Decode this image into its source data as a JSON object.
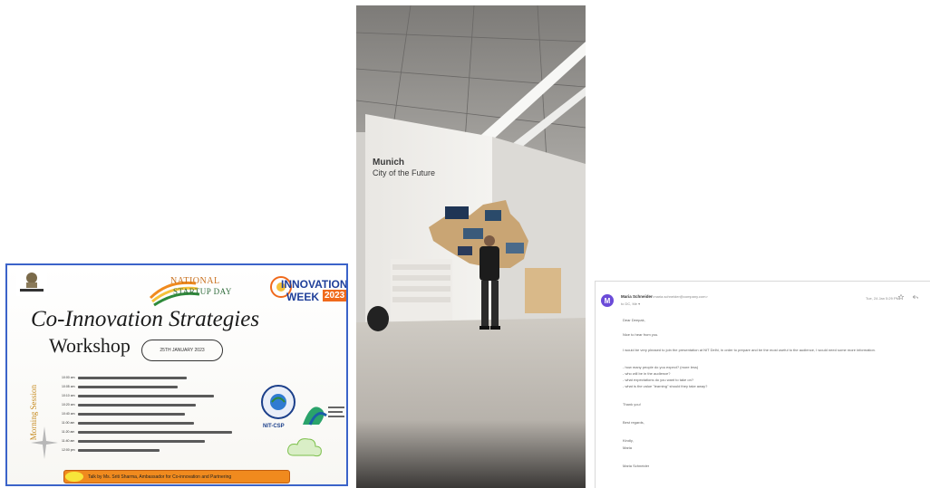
{
  "poster": {
    "title": "Co-Innovation Strategies",
    "subtitle": "Workshop",
    "date": "25TH JANUARY 2023",
    "startup_line1": "NATIONAL",
    "startup_line2": "STARTUP DAY",
    "innovation_line1": "INNOVATION",
    "innovation_line2": "WEEK",
    "innovation_year": "2023",
    "side_text": "Morning Session",
    "nit_label": "NIT-CSP",
    "schedule": [
      {
        "time": "10:00 am",
        "text": "Welcome Address By Dr. Deepak Bansal"
      },
      {
        "time": "10:05 am",
        "text": "Inaugural Address By Director NITSRITCH Delhi"
      },
      {
        "time": "10:10 am",
        "text": "Chief Guest Address By Ms. Surya Kumar Bose (Founder IIT Chennai)"
      },
      {
        "time": "10:20 am",
        "text": "Innovation Talk By Ms. Lee Ima (Hamburg Germany)"
      },
      {
        "time": "10:40 am",
        "text": "Co-innovation India Talk By Shri N Ramanan"
      },
      {
        "time": "11:00 am",
        "text": "Innovation Ecosystems in Austria By Mr. Walter Ofmair"
      },
      {
        "time": "11:20 am",
        "text": "Roleplay For Students Startups on International Path By Ms Maria Schneider"
      },
      {
        "time": "11:40 am",
        "text": "Technopreneurship in Japan By Mr. Kawashiki AIMSIL Japan"
      },
      {
        "time": "12:00 pm",
        "text": "Vote of Thanks By Dr. Deepak Bhat"
      }
    ],
    "footer": "Talk by Ms. Sriti Sharma, Ambassador for Co-innovation and Partnering"
  },
  "photo": {
    "wall_title_line1": "Munich",
    "wall_title_line2": "City of the Future"
  },
  "email": {
    "avatar_initial": "M",
    "sender": "Maria Schneider",
    "sender_addr": "<maria.schneider@company.com>",
    "to_line": "to DC, Me ▾",
    "timestamp": "Tue, 24 Jan 5:29 PM",
    "lines": [
      "Dear Deepak,",
      "Nice to hear from you.",
      "I would be very pleased to join the presentation at NIT Delhi, in order to prepare and be the most useful to the audience, I would need some more information.",
      "- how many people do you expect? (more less)",
      "- who will be in the audience?",
      "- what expectations do you want to take on?",
      "- what is the value \"learning\" should they take away?",
      "Thank you!",
      "Best regards,",
      "Kindly,",
      "Maria",
      "Maria Schneider"
    ]
  }
}
